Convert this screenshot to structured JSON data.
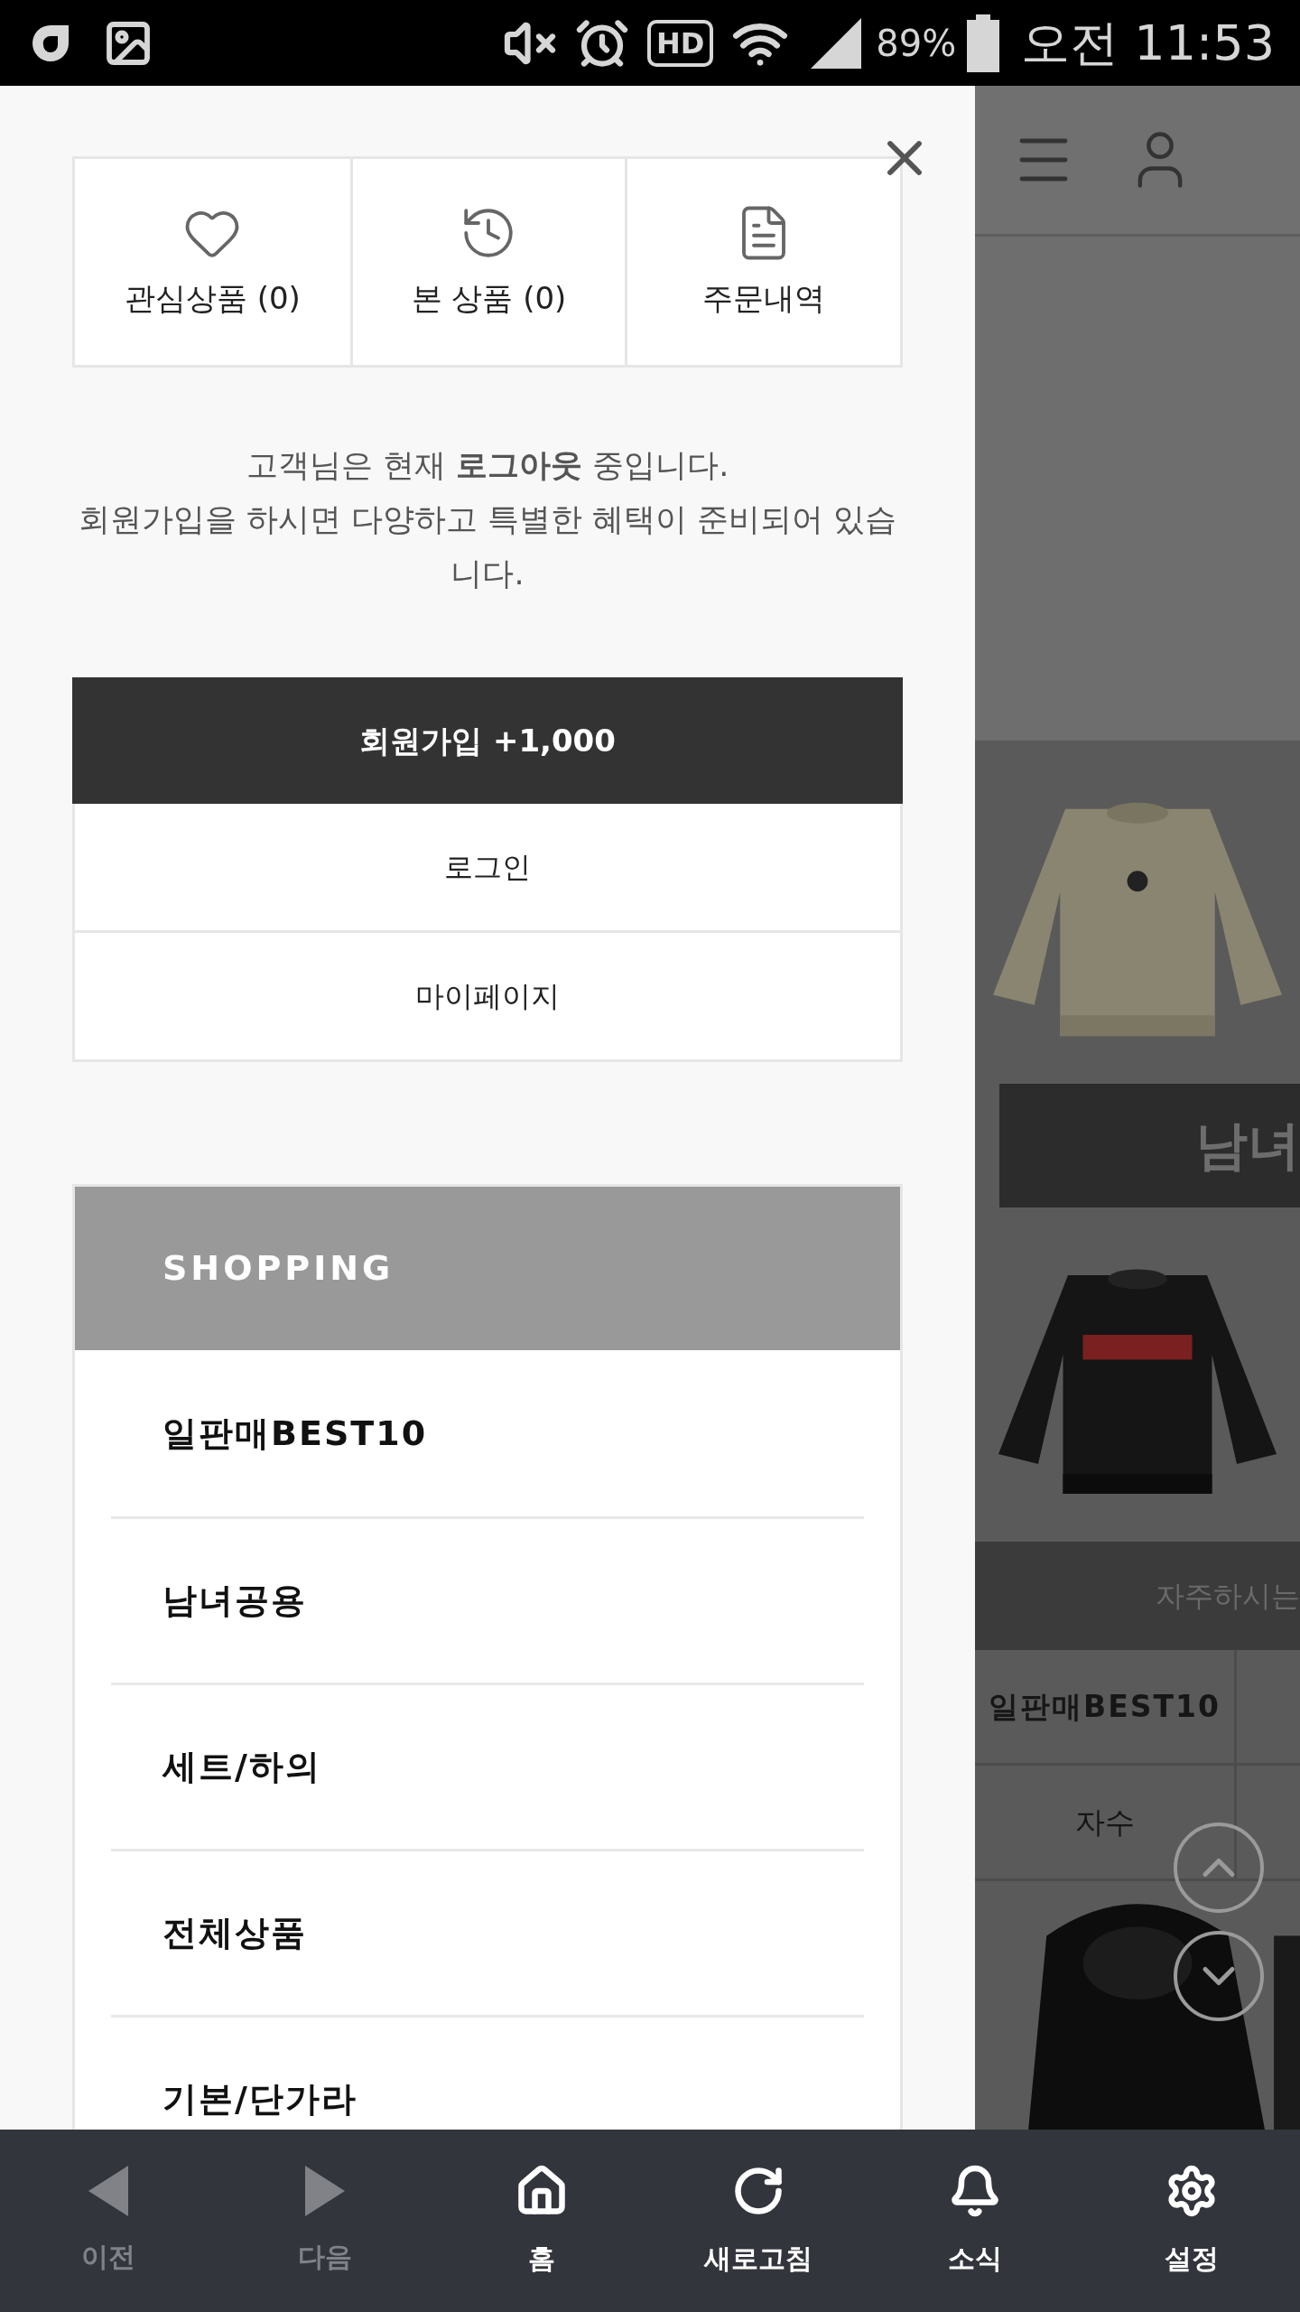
{
  "status_bar": {
    "hd": "HD",
    "battery": "89%",
    "time": "오전 11:53"
  },
  "drawer": {
    "quick_links": [
      {
        "label": "관심상품 (0)"
      },
      {
        "label": "본 상품 (0)"
      },
      {
        "label": "주문내역"
      }
    ],
    "message": [
      "고객님은 현재 **로그아웃** 중입니다.",
      "회원가입을 하시면 다양하고 특별한 혜택이 준비되어 있습니다."
    ],
    "buttons": [
      {
        "label": "회원가입 +1,000",
        "kind": "primary"
      },
      {
        "label": "로그인",
        "kind": "secondary"
      },
      {
        "label": "마이페이지",
        "kind": "secondary"
      }
    ],
    "menu": {
      "title": "SHOPPING",
      "items": [
        "일판매BEST10",
        "남녀공용",
        "세트/하의",
        "전체상품",
        "기본/단가라"
      ]
    }
  },
  "background_page": {
    "banner": "남녀",
    "faq_bar": "자주하시는",
    "table_cells": [
      "일판매BEST10",
      "자수"
    ]
  },
  "bottom_nav": [
    {
      "label": "이전",
      "disabled": true
    },
    {
      "label": "다음",
      "disabled": true
    },
    {
      "label": "홈",
      "disabled": false
    },
    {
      "label": "새로고침",
      "disabled": false
    },
    {
      "label": "소식",
      "disabled": false
    },
    {
      "label": "설정",
      "disabled": false
    }
  ]
}
